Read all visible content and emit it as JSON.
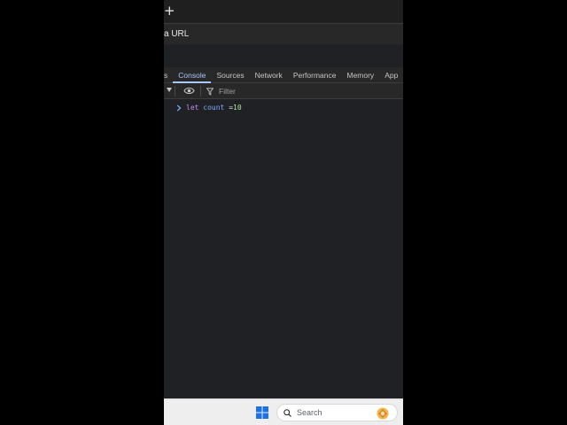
{
  "browser": {
    "new_tab_glyph": "+",
    "address_fragment": "a URL"
  },
  "devtools": {
    "tabs": [
      {
        "label": "s",
        "active": false
      },
      {
        "label": "Console",
        "active": true
      },
      {
        "label": "Sources",
        "active": false
      },
      {
        "label": "Network",
        "active": false
      },
      {
        "label": "Performance",
        "active": false
      },
      {
        "label": "Memory",
        "active": false
      },
      {
        "label": "App",
        "active": false
      }
    ],
    "toolbar": {
      "filter_label": "Filter"
    }
  },
  "console": {
    "input": {
      "keyword": "let",
      "identifier": "count",
      "operator": "=",
      "value": "10"
    }
  },
  "taskbar": {
    "search_label": "Search"
  },
  "icons": {
    "new_tab": "plus-icon",
    "toolbar_dropdown": "caret-down-icon",
    "live_expression": "eye-icon",
    "filter": "filter-icon",
    "prompt": "chevron-right-icon",
    "start": "windows-logo-icon",
    "search": "search-icon",
    "widget": "widget-icon"
  },
  "colors": {
    "active_tab": "#a8c7fa",
    "keyword": "#c58af9",
    "identifier": "#7cacf8",
    "number": "#b6e3a1",
    "windows_blue": "#1a73e8"
  }
}
